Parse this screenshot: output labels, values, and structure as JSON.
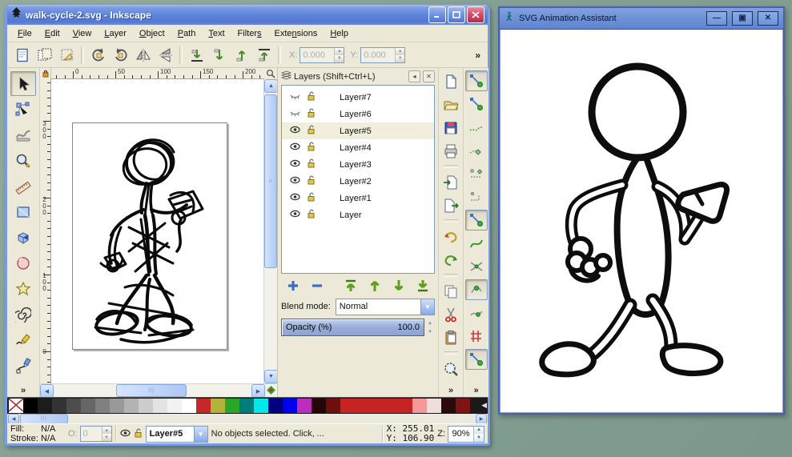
{
  "inkscape": {
    "title": "walk-cycle-2.svg - Inkscape",
    "menu": [
      {
        "label": "File",
        "u": 0
      },
      {
        "label": "Edit",
        "u": 0
      },
      {
        "label": "View",
        "u": 0
      },
      {
        "label": "Layer",
        "u": 0
      },
      {
        "label": "Object",
        "u": 0
      },
      {
        "label": "Path",
        "u": 0
      },
      {
        "label": "Text",
        "u": 0
      },
      {
        "label": "Filters",
        "u": 6
      },
      {
        "label": "Extensions",
        "u": 4
      },
      {
        "label": "Help",
        "u": 0
      }
    ],
    "tool_controls": {
      "buttons": [
        "select-all",
        "select-all-layers",
        "deselect",
        "rotate-ccw",
        "rotate-cw",
        "flip-horizontal",
        "flip-vertical",
        "lower-to-bottom",
        "lower",
        "raise",
        "raise-to-top"
      ],
      "x_label": "X:",
      "x_value": "0.000",
      "y_label": "Y:",
      "y_value": "0.000",
      "overflow": "»"
    },
    "toolbox": {
      "tools": [
        "selector",
        "node-editor",
        "tweak",
        "zoom",
        "measure",
        "rectangle",
        "box-3d",
        "ellipse",
        "star",
        "spiral",
        "pencil",
        "calligraphy"
      ],
      "active": "selector",
      "overflow": "»"
    },
    "commands": [
      "new-document",
      "open",
      "save",
      "print",
      "import",
      "export",
      "undo",
      "redo",
      "copy",
      "cut",
      "paste",
      "zoom-drawing"
    ],
    "commands_overflow": "»",
    "snap": {
      "buttons": [
        {
          "name": "snap-enable",
          "pressed": true
        },
        {
          "name": "snap-bounding-box",
          "pressed": false
        },
        {
          "name": "snap-bbox-edges",
          "pressed": false
        },
        {
          "name": "snap-bbox-corners",
          "pressed": false
        },
        {
          "name": "snap-edge-midpoints",
          "pressed": false
        },
        {
          "name": "snap-bbox-centers",
          "pressed": false
        },
        {
          "name": "snap-nodes",
          "pressed": true
        },
        {
          "name": "snap-paths",
          "pressed": false
        },
        {
          "name": "snap-path-intersections",
          "pressed": false
        },
        {
          "name": "snap-cusp-nodes",
          "pressed": true
        },
        {
          "name": "snap-smooth-nodes",
          "pressed": false
        },
        {
          "name": "snap-midpoints",
          "pressed": false
        },
        {
          "name": "snap-others",
          "pressed": true
        }
      ],
      "overflow": "»"
    },
    "ruler": {
      "h_labels": [
        "0",
        "50",
        "100",
        "150",
        "200"
      ],
      "v_labels": [
        "300",
        "200",
        "100",
        "0"
      ]
    },
    "layers_panel": {
      "title": "Layers (Shift+Ctrl+L)",
      "rows": [
        {
          "name": "Layer#7",
          "visible": false,
          "locked": false,
          "selected": false
        },
        {
          "name": "Layer#6",
          "visible": false,
          "locked": false,
          "selected": false
        },
        {
          "name": "Layer#5",
          "visible": true,
          "locked": false,
          "selected": true
        },
        {
          "name": "Layer#4",
          "visible": true,
          "locked": false,
          "selected": false
        },
        {
          "name": "Layer#3",
          "visible": true,
          "locked": false,
          "selected": false
        },
        {
          "name": "Layer#2",
          "visible": true,
          "locked": false,
          "selected": false
        },
        {
          "name": "Layer#1",
          "visible": true,
          "locked": false,
          "selected": false
        },
        {
          "name": "Layer",
          "visible": true,
          "locked": false,
          "selected": false
        }
      ],
      "buttons": [
        "add-layer",
        "remove-layer",
        "raise-to-top",
        "raise",
        "lower",
        "lower-to-bottom"
      ],
      "blend_label": "Blend mode:",
      "blend_value": "Normal",
      "opacity_label": "Opacity (%)",
      "opacity_value": "100.0"
    },
    "palette": [
      "none",
      "#000000",
      "#1c1c1c",
      "#333333",
      "#4d4d4d",
      "#666666",
      "#808080",
      "#999999",
      "#b3b3b3",
      "#cccccc",
      "#e3e3e3",
      "#f2f2f2",
      "#ffffff",
      "#c62828",
      "#b3b33a",
      "#2aa52a",
      "#007d7d",
      "#00e8e8",
      "#000080",
      "#0000f0",
      "#bb2dbb",
      "#240606",
      "#6e0f0f",
      "#c62323",
      "#c62323",
      "#c62323",
      "#c62323",
      "#c62323",
      "#f79898",
      "#efdede",
      "#2a0a0a",
      "#801414"
    ],
    "status": {
      "fill_label": "Fill:",
      "fill_value": "N/A",
      "stroke_label": "Stroke:",
      "stroke_value": "N/A",
      "o_label": "O:",
      "o_value": "0",
      "layer_value": "Layer#5",
      "message": "No objects selected. Click, ...",
      "x_label": "X:",
      "x_value": "255.01",
      "y_label": "Y:",
      "y_value": "106.90",
      "z_label": "Z:",
      "z_value": "90%"
    }
  },
  "assistant": {
    "title": "SVG Animation Assistant"
  },
  "colors": {
    "titlebar_blue": "#5e83d9",
    "panel_cream": "#ece9d8",
    "desktop_teal": "#84a093",
    "selection_highlight": "#f1eedb"
  }
}
